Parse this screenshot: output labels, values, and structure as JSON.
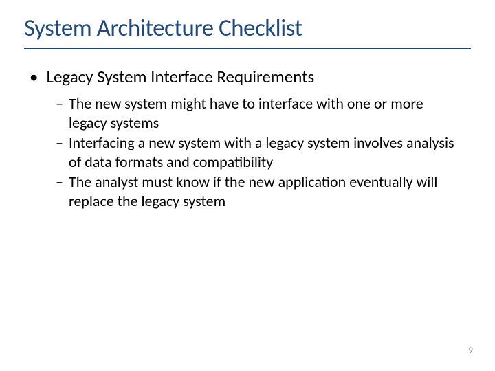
{
  "title": "System Architecture Checklist",
  "main_bullet": "Legacy System Interface Requirements",
  "sub_items": [
    "The new system might have to interface with one or more legacy systems",
    "Interfacing a new system with a legacy system involves analysis of data formats and compatibility",
    "The analyst must know if the new application eventually will replace the legacy system"
  ],
  "page_number": "9"
}
